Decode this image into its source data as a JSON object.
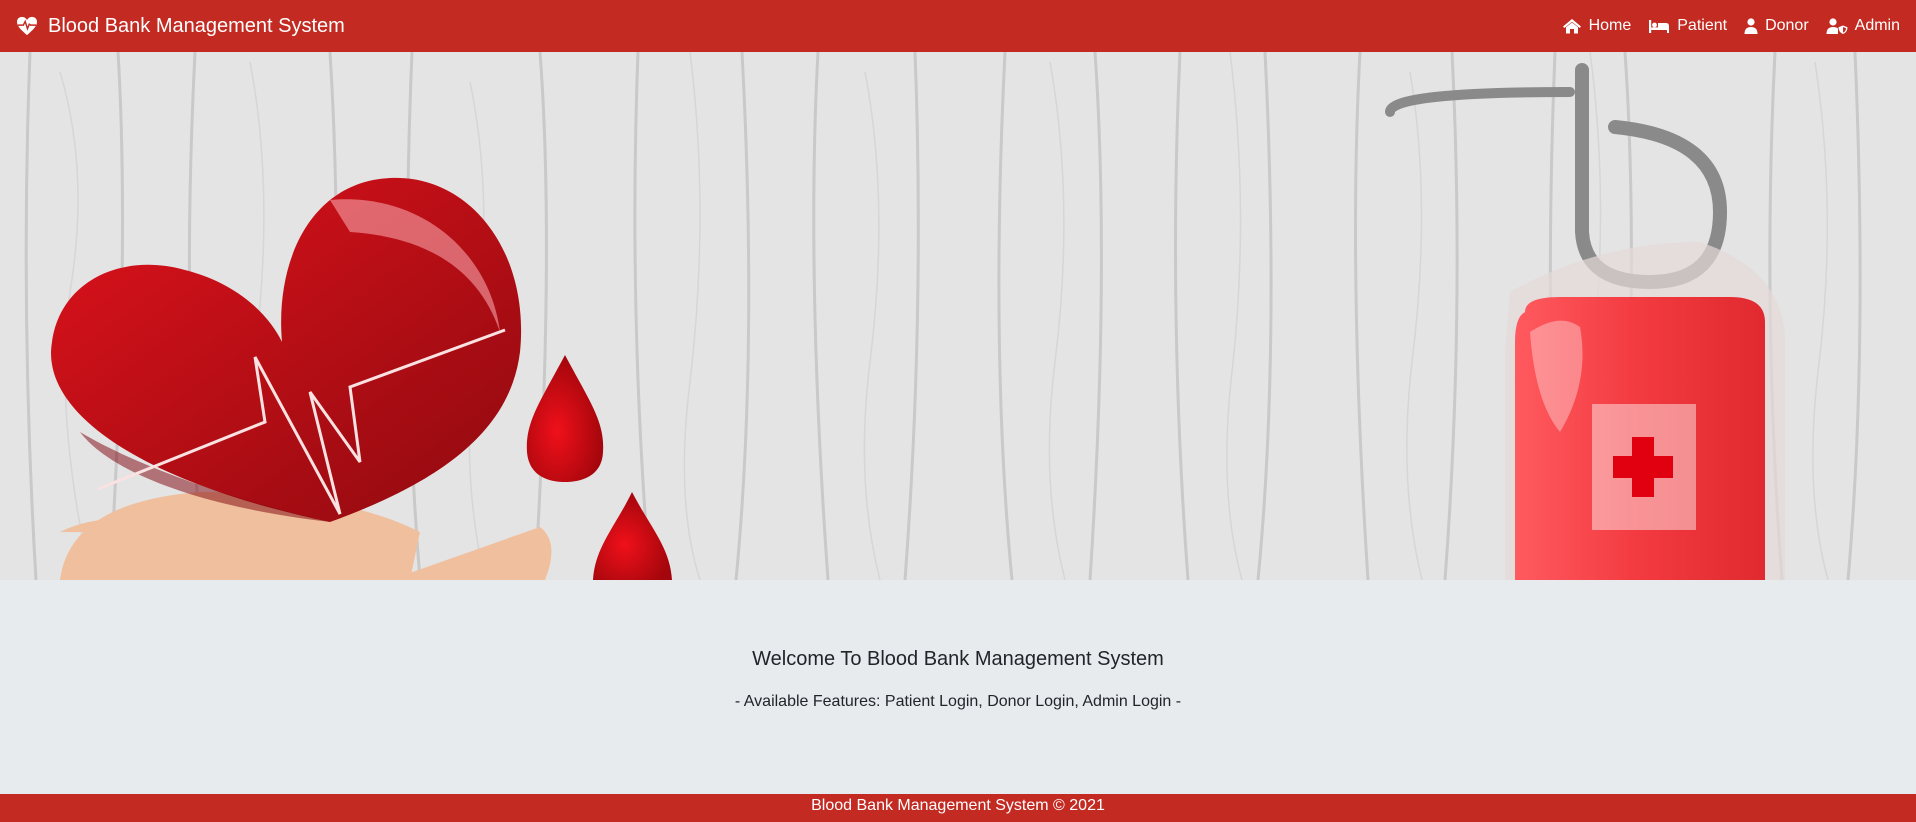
{
  "navbar": {
    "brand": {
      "title": "Blood Bank Management System",
      "icon": "heartbeat-icon"
    },
    "links": [
      {
        "label": "Home",
        "icon": "home-icon"
      },
      {
        "label": "Patient",
        "icon": "bed-icon"
      },
      {
        "label": "Donor",
        "icon": "user-icon"
      },
      {
        "label": "Admin",
        "icon": "user-shield-icon"
      }
    ]
  },
  "hero": {
    "illustration": [
      "heart-in-hand",
      "blood-drops",
      "blood-bag-with-cross"
    ]
  },
  "welcome": {
    "heading": "Welcome To Blood Bank Management System",
    "features": "- Available Features: Patient Login, Donor Login, Admin Login -"
  },
  "footer": {
    "text": "Blood Bank Management System © 2021"
  },
  "colors": {
    "brand_red": "#c32a22",
    "welcome_bg": "#e8ebee",
    "hero_bg": "#e4e4e4"
  }
}
